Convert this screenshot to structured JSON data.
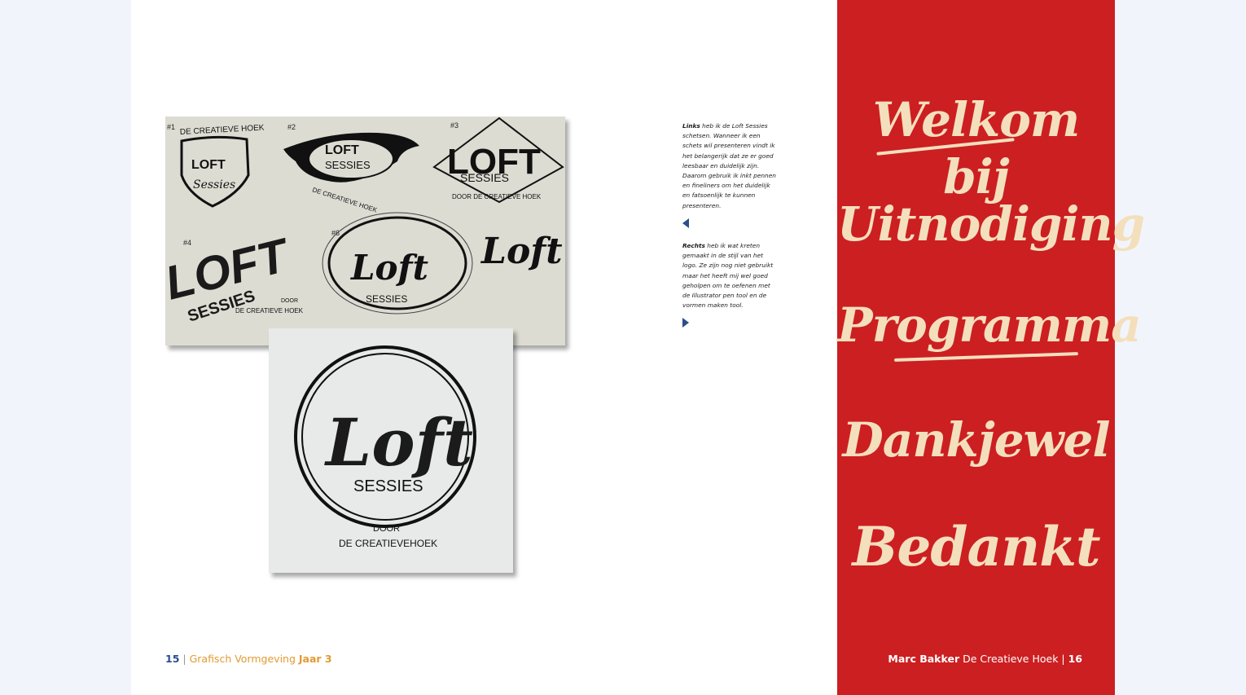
{
  "left_page": {
    "text_1_bold": "Links",
    "text_1": " heb ik de Loft Sessies schetsen. Wanneer ik een schets wil presenteren vindt ik het belangerijk dat ze er goed leesbaar en duidelijk zijn. Daarom gebruik ik inkt pennen en fineliners om het duidelijk en fatsoenlijk te kunnen presenteren.",
    "text_2_bold": "Rechts",
    "text_2": " heb ik wat kreten gemaakt in de stijl van het logo. Ze zijn nog niet gebruikt maar het heeft mij wel goed geholpen om te oefenen met de Illustrator pen tool en de vormen maken tool.",
    "sketch_1": {
      "n1": "#1",
      "n2": "#2",
      "n3": "#3",
      "n4": "#4",
      "n6": "#6",
      "creatieve_hoek": "DE CREATIEVE HOEK",
      "loft": "LOFT",
      "sessies_script": "Sessies",
      "sessies": "SESSIES",
      "door": "DOOR",
      "loft_script": "Loft",
      "door_de_creatieve_hoek": "DOOR DE CREATIEVE HOEK",
      "de_creatieve_hoek": "DE CREATIEVE HOEK"
    },
    "sketch_2": {
      "loft": "Loft",
      "sessies": "SESSIES",
      "door": "DOOR",
      "creatievehoek": "DE CREATIEVEHOEK"
    },
    "footer": {
      "page": "15",
      "sep": " | ",
      "course": "Grafisch Vormgeving ",
      "year": "Jaar 3"
    }
  },
  "right_page": {
    "script_lines": [
      "Welkom bij",
      "Uitnodiging",
      "Programma",
      "Dankjewel",
      "Bedankt"
    ],
    "footer": {
      "author": "Marc Bakker",
      "studio": " De Creatieve Hoek | ",
      "page": "16"
    }
  },
  "colors": {
    "red": "#cc1f21",
    "cream": "#f4dfbd",
    "blue": "#2a4e8f",
    "orange": "#e29a32"
  }
}
